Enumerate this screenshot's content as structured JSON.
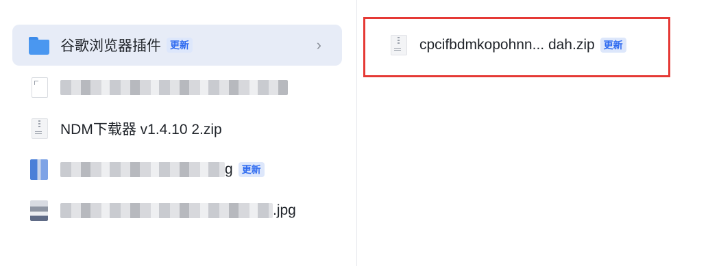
{
  "left_list": {
    "items": [
      {
        "label": "谷歌浏览器插件",
        "badge": "更新",
        "chevron": "›",
        "icon": "folder-icon",
        "selected": true
      },
      {
        "label": "",
        "icon": "doc-icon",
        "redacted": true
      },
      {
        "label": "NDM下载器 v1.4.10 2.zip",
        "icon": "zip-file-icon"
      },
      {
        "label_tail": "g",
        "badge": "更新",
        "icon": "image-file-icon",
        "redacted": true
      },
      {
        "label_tail": ".jpg",
        "icon": "image-file-icon",
        "redacted": true
      }
    ]
  },
  "right_list": {
    "items": [
      {
        "label": "cpcifbdmkopohnn... dah.zip",
        "badge": "更新",
        "icon": "zip-file-icon"
      }
    ]
  },
  "colors": {
    "selected_bg": "#e7ecf7",
    "badge_text": "#2f6bf0",
    "badge_bg": "#dde7fb",
    "folder": "#4a97f0",
    "highlight": "#e53935"
  }
}
